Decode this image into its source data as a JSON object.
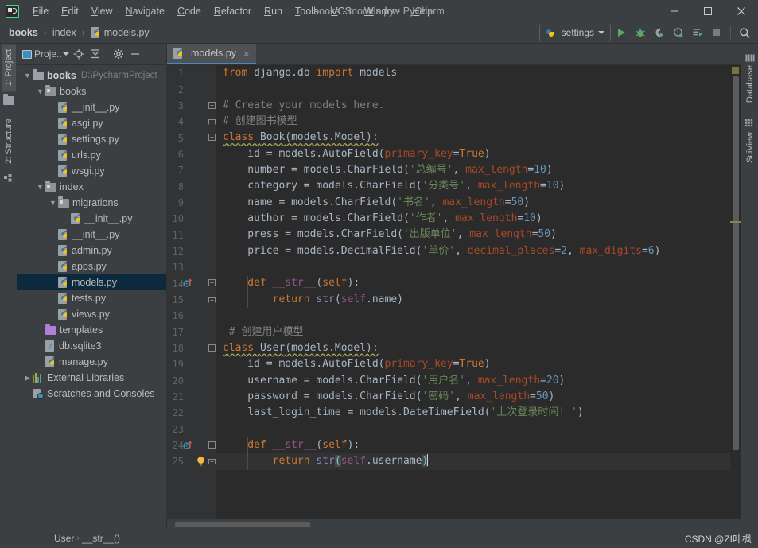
{
  "window": {
    "title": "books - models.py - PyCharm",
    "app_icon": "pycharm-logo-icon",
    "minimize_label": "minimize-icon",
    "maximize_label": "maximize-icon",
    "close_label": "close-icon"
  },
  "menubar": {
    "items": [
      {
        "label": "File"
      },
      {
        "label": "Edit"
      },
      {
        "label": "View"
      },
      {
        "label": "Navigate"
      },
      {
        "label": "Code"
      },
      {
        "label": "Refactor"
      },
      {
        "label": "Run"
      },
      {
        "label": "Tools"
      },
      {
        "label": "VCS"
      },
      {
        "label": "Window"
      },
      {
        "label": "Help"
      }
    ]
  },
  "navbar": {
    "breadcrumbs": [
      {
        "label": "books",
        "bold": true,
        "icon": null
      },
      {
        "label": "index",
        "bold": false,
        "icon": null
      },
      {
        "label": "models.py",
        "bold": false,
        "icon": "python-file-icon"
      }
    ],
    "run_config": {
      "label": "settings",
      "icon": "python-icon",
      "dropdown": "chevron-down-icon"
    },
    "actions": [
      {
        "name": "run-button",
        "glyph": "▶"
      },
      {
        "name": "debug-button",
        "glyph": "bug"
      },
      {
        "name": "run-coverage-button",
        "glyph": "coverage"
      },
      {
        "name": "profile-button",
        "glyph": "profile"
      },
      {
        "name": "run-with-console-button",
        "glyph": "console"
      },
      {
        "name": "stop-button",
        "glyph": "■"
      },
      {
        "name": "search-everywhere-button",
        "glyph": "search"
      }
    ]
  },
  "left_tool_strip": {
    "tabs": [
      {
        "label": "1: Project",
        "icon": "project-icon",
        "active": true
      },
      {
        "label": "2: Structure",
        "icon": "structure-icon",
        "active": false
      }
    ]
  },
  "right_tool_strip": {
    "tabs": [
      {
        "label": "Database",
        "icon": "database-icon"
      },
      {
        "label": "SciView",
        "icon": "sciview-icon"
      }
    ]
  },
  "project_panel": {
    "title": "Proje..",
    "toolbar": [
      {
        "name": "locate-icon"
      },
      {
        "name": "collapse-all-icon"
      },
      {
        "name": "settings-gear-icon"
      },
      {
        "name": "hide-panel-icon"
      }
    ],
    "tree": [
      {
        "depth": 0,
        "label": "books",
        "path": "D:\\PycharmProject",
        "icon": "folder",
        "twisty": "down",
        "bold": true,
        "selected": false
      },
      {
        "depth": 1,
        "label": "books",
        "path": "",
        "icon": "folder-src",
        "twisty": "down",
        "bold": false,
        "selected": false
      },
      {
        "depth": 2,
        "label": "__init__.py",
        "path": "",
        "icon": "python-file",
        "twisty": "",
        "bold": false,
        "selected": false
      },
      {
        "depth": 2,
        "label": "asgi.py",
        "path": "",
        "icon": "python-file",
        "twisty": "",
        "bold": false,
        "selected": false
      },
      {
        "depth": 2,
        "label": "settings.py",
        "path": "",
        "icon": "python-file",
        "twisty": "",
        "bold": false,
        "selected": false
      },
      {
        "depth": 2,
        "label": "urls.py",
        "path": "",
        "icon": "python-file",
        "twisty": "",
        "bold": false,
        "selected": false
      },
      {
        "depth": 2,
        "label": "wsgi.py",
        "path": "",
        "icon": "python-file",
        "twisty": "",
        "bold": false,
        "selected": false
      },
      {
        "depth": 1,
        "label": "index",
        "path": "",
        "icon": "folder-src",
        "twisty": "down",
        "bold": false,
        "selected": false
      },
      {
        "depth": 2,
        "label": "migrations",
        "path": "",
        "icon": "folder-src",
        "twisty": "down",
        "bold": false,
        "selected": false
      },
      {
        "depth": 3,
        "label": "__init__.py",
        "path": "",
        "icon": "python-file",
        "twisty": "",
        "bold": false,
        "selected": false
      },
      {
        "depth": 2,
        "label": "__init__.py",
        "path": "",
        "icon": "python-file",
        "twisty": "",
        "bold": false,
        "selected": false
      },
      {
        "depth": 2,
        "label": "admin.py",
        "path": "",
        "icon": "python-file",
        "twisty": "",
        "bold": false,
        "selected": false
      },
      {
        "depth": 2,
        "label": "apps.py",
        "path": "",
        "icon": "python-file",
        "twisty": "",
        "bold": false,
        "selected": false
      },
      {
        "depth": 2,
        "label": "models.py",
        "path": "",
        "icon": "python-file",
        "twisty": "",
        "bold": false,
        "selected": true
      },
      {
        "depth": 2,
        "label": "tests.py",
        "path": "",
        "icon": "python-file",
        "twisty": "",
        "bold": false,
        "selected": false
      },
      {
        "depth": 2,
        "label": "views.py",
        "path": "",
        "icon": "python-file",
        "twisty": "",
        "bold": false,
        "selected": false
      },
      {
        "depth": 1,
        "label": "templates",
        "path": "",
        "icon": "folder-purple",
        "twisty": "",
        "bold": false,
        "selected": false
      },
      {
        "depth": 1,
        "label": "db.sqlite3",
        "path": "",
        "icon": "db-file",
        "twisty": "",
        "bold": false,
        "selected": false
      },
      {
        "depth": 1,
        "label": "manage.py",
        "path": "",
        "icon": "python-file",
        "twisty": "",
        "bold": false,
        "selected": false
      },
      {
        "depth": 0,
        "label": "External Libraries",
        "path": "",
        "icon": "library",
        "twisty": "right",
        "bold": false,
        "selected": false
      },
      {
        "depth": 0,
        "label": "Scratches and Consoles",
        "path": "",
        "icon": "scratches",
        "twisty": "",
        "bold": false,
        "selected": false
      }
    ]
  },
  "editor": {
    "tabs": [
      {
        "label": "models.py",
        "icon": "python-file-icon",
        "active": true,
        "close": "×"
      }
    ],
    "first_line": 1,
    "lines": [
      {
        "n": 1,
        "fold": "",
        "marker": "",
        "segments": [
          {
            "t": "from ",
            "c": "kw"
          },
          {
            "t": "django.db ",
            "c": "plain"
          },
          {
            "t": "import ",
            "c": "kw"
          },
          {
            "t": "models",
            "c": "plain"
          }
        ]
      },
      {
        "n": 2,
        "fold": "",
        "marker": "",
        "segments": []
      },
      {
        "n": 3,
        "fold": "top",
        "marker": "",
        "segments": [
          {
            "t": "# Create your models here.",
            "c": "cmt"
          }
        ]
      },
      {
        "n": 4,
        "fold": "end",
        "marker": "",
        "segments": [
          {
            "t": "# 创建图书模型",
            "c": "cmt"
          }
        ]
      },
      {
        "n": 5,
        "fold": "top",
        "marker": "",
        "segments": [
          {
            "t": "class ",
            "c": "kw squig"
          },
          {
            "t": "Book",
            "c": "plain squig"
          },
          {
            "t": "(models.Model):",
            "c": "plain squig"
          }
        ]
      },
      {
        "n": 6,
        "fold": "",
        "marker": "",
        "segments": [
          {
            "t": "    id = models.AutoField(",
            "c": "plain"
          },
          {
            "t": "primary_key",
            "c": "param"
          },
          {
            "t": "=",
            "c": "plain"
          },
          {
            "t": "True",
            "c": "kw"
          },
          {
            "t": ")",
            "c": "plain"
          }
        ]
      },
      {
        "n": 7,
        "fold": "",
        "marker": "",
        "segments": [
          {
            "t": "    number = models.CharField(",
            "c": "plain"
          },
          {
            "t": "'总编号'",
            "c": "str"
          },
          {
            "t": ", ",
            "c": "plain"
          },
          {
            "t": "max_length",
            "c": "param"
          },
          {
            "t": "=",
            "c": "plain"
          },
          {
            "t": "10",
            "c": "num"
          },
          {
            "t": ")",
            "c": "plain"
          }
        ]
      },
      {
        "n": 8,
        "fold": "",
        "marker": "",
        "segments": [
          {
            "t": "    category = models.CharField(",
            "c": "plain"
          },
          {
            "t": "'分类号'",
            "c": "str"
          },
          {
            "t": ", ",
            "c": "plain"
          },
          {
            "t": "max_length",
            "c": "param"
          },
          {
            "t": "=",
            "c": "plain"
          },
          {
            "t": "10",
            "c": "num"
          },
          {
            "t": ")",
            "c": "plain"
          }
        ]
      },
      {
        "n": 9,
        "fold": "",
        "marker": "",
        "segments": [
          {
            "t": "    name = models.CharField(",
            "c": "plain"
          },
          {
            "t": "'书名'",
            "c": "str"
          },
          {
            "t": ", ",
            "c": "plain"
          },
          {
            "t": "max_length",
            "c": "param"
          },
          {
            "t": "=",
            "c": "plain"
          },
          {
            "t": "50",
            "c": "num"
          },
          {
            "t": ")",
            "c": "plain"
          }
        ]
      },
      {
        "n": 10,
        "fold": "",
        "marker": "",
        "segments": [
          {
            "t": "    author = models.CharField(",
            "c": "plain"
          },
          {
            "t": "'作者'",
            "c": "str"
          },
          {
            "t": ", ",
            "c": "plain"
          },
          {
            "t": "max_length",
            "c": "param"
          },
          {
            "t": "=",
            "c": "plain"
          },
          {
            "t": "10",
            "c": "num"
          },
          {
            "t": ")",
            "c": "plain"
          }
        ]
      },
      {
        "n": 11,
        "fold": "",
        "marker": "",
        "segments": [
          {
            "t": "    press = models.CharField(",
            "c": "plain"
          },
          {
            "t": "'出版单位'",
            "c": "str"
          },
          {
            "t": ", ",
            "c": "plain"
          },
          {
            "t": "max_length",
            "c": "param"
          },
          {
            "t": "=",
            "c": "plain"
          },
          {
            "t": "50",
            "c": "num"
          },
          {
            "t": ")",
            "c": "plain"
          }
        ]
      },
      {
        "n": 12,
        "fold": "",
        "marker": "",
        "segments": [
          {
            "t": "    price = models.DecimalField(",
            "c": "plain"
          },
          {
            "t": "'单价'",
            "c": "str"
          },
          {
            "t": ", ",
            "c": "plain"
          },
          {
            "t": "decimal_places",
            "c": "param"
          },
          {
            "t": "=",
            "c": "plain"
          },
          {
            "t": "2",
            "c": "num"
          },
          {
            "t": ", ",
            "c": "plain"
          },
          {
            "t": "max_digits",
            "c": "param"
          },
          {
            "t": "=",
            "c": "plain"
          },
          {
            "t": "6",
            "c": "num"
          },
          {
            "t": ")",
            "c": "plain"
          }
        ]
      },
      {
        "n": 13,
        "fold": "",
        "marker": "",
        "segments": []
      },
      {
        "n": 14,
        "fold": "top",
        "marker": "override",
        "segments": [
          {
            "t": "    def ",
            "c": "kw"
          },
          {
            "t": "__str__",
            "c": "self"
          },
          {
            "t": "(",
            "c": "plain"
          },
          {
            "t": "self",
            "c": "kw"
          },
          {
            "t": "):",
            "c": "plain"
          }
        ]
      },
      {
        "n": 15,
        "fold": "end",
        "marker": "",
        "segments": [
          {
            "t": "        return ",
            "c": "kw"
          },
          {
            "t": "str",
            "c": "builtin"
          },
          {
            "t": "(",
            "c": "plain"
          },
          {
            "t": "self",
            "c": "self"
          },
          {
            "t": ".name)",
            "c": "plain"
          }
        ]
      },
      {
        "n": 16,
        "fold": "",
        "marker": "",
        "segments": []
      },
      {
        "n": 17,
        "fold": "",
        "marker": "",
        "segments": [
          {
            "t": " # 创建用户模型",
            "c": "cmt"
          }
        ]
      },
      {
        "n": 18,
        "fold": "top",
        "marker": "",
        "segments": [
          {
            "t": "class ",
            "c": "kw squig"
          },
          {
            "t": "User",
            "c": "plain squig"
          },
          {
            "t": "(models.Model):",
            "c": "plain squig"
          }
        ]
      },
      {
        "n": 19,
        "fold": "",
        "marker": "",
        "segments": [
          {
            "t": "    id = models.AutoField(",
            "c": "plain"
          },
          {
            "t": "primary_key",
            "c": "param"
          },
          {
            "t": "=",
            "c": "plain"
          },
          {
            "t": "True",
            "c": "kw"
          },
          {
            "t": ")",
            "c": "plain"
          }
        ]
      },
      {
        "n": 20,
        "fold": "",
        "marker": "",
        "segments": [
          {
            "t": "    username = models.CharField(",
            "c": "plain"
          },
          {
            "t": "'用户名'",
            "c": "str"
          },
          {
            "t": ", ",
            "c": "plain"
          },
          {
            "t": "max_length",
            "c": "param"
          },
          {
            "t": "=",
            "c": "plain"
          },
          {
            "t": "20",
            "c": "num"
          },
          {
            "t": ")",
            "c": "plain"
          }
        ]
      },
      {
        "n": 21,
        "fold": "",
        "marker": "",
        "segments": [
          {
            "t": "    password = models.CharField(",
            "c": "plain"
          },
          {
            "t": "'密码'",
            "c": "str"
          },
          {
            "t": ", ",
            "c": "plain"
          },
          {
            "t": "max_length",
            "c": "param"
          },
          {
            "t": "=",
            "c": "plain"
          },
          {
            "t": "50",
            "c": "num"
          },
          {
            "t": ")",
            "c": "plain"
          }
        ]
      },
      {
        "n": 22,
        "fold": "",
        "marker": "",
        "segments": [
          {
            "t": "    last_login_time = models.DateTimeField(",
            "c": "plain"
          },
          {
            "t": "'上次登录时间! '",
            "c": "str"
          },
          {
            "t": ")",
            "c": "plain"
          }
        ]
      },
      {
        "n": 23,
        "fold": "",
        "marker": "",
        "segments": []
      },
      {
        "n": 24,
        "fold": "top",
        "marker": "override",
        "segments": [
          {
            "t": "    def ",
            "c": "kw"
          },
          {
            "t": "__str__",
            "c": "self"
          },
          {
            "t": "(",
            "c": "plain"
          },
          {
            "t": "self",
            "c": "kw"
          },
          {
            "t": "):",
            "c": "plain"
          }
        ]
      },
      {
        "n": 25,
        "fold": "end",
        "marker": "bulb",
        "cursorline": true,
        "segments": [
          {
            "t": "        return ",
            "c": "kw"
          },
          {
            "t": "str",
            "c": "builtin"
          },
          {
            "t": "(",
            "c": "brkt"
          },
          {
            "t": "self",
            "c": "self"
          },
          {
            "t": ".username",
            "c": "plain"
          },
          {
            "t": ")",
            "c": "brkt"
          }
        ]
      }
    ]
  },
  "statusbar": {
    "breadcrumbs": [
      {
        "label": "User"
      },
      {
        "label": "__str__()"
      }
    ],
    "watermark": "CSDN @ZI叶枫"
  },
  "colors": {
    "chrome_bg": "#3c3f41",
    "editor_bg": "#2b2b2b",
    "gutter_bg": "#313335",
    "accent_blue": "#4a88c7",
    "selection": "#0d293e",
    "keyword": "#cc7832",
    "string": "#6a8759",
    "number": "#6897bb",
    "comment": "#808080",
    "param": "#aa4926",
    "magenta": "#94558d",
    "green_run": "#59a869"
  }
}
